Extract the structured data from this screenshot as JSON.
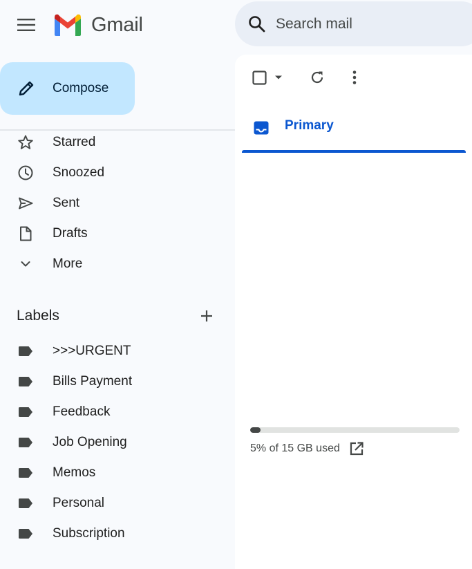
{
  "app": {
    "name": "Gmail"
  },
  "header": {
    "search": {
      "placeholder": "Search mail",
      "value": ""
    },
    "icons": {
      "menu": "hamburger-menu-icon",
      "logo": "gmail-m-logo",
      "search": "magnifier-icon"
    }
  },
  "compose": {
    "label": "Compose",
    "icon": "pencil-icon"
  },
  "nav": {
    "items": [
      {
        "label": "Starred",
        "icon": "star-icon"
      },
      {
        "label": "Snoozed",
        "icon": "clock-icon"
      },
      {
        "label": "Sent",
        "icon": "send-icon"
      },
      {
        "label": "Drafts",
        "icon": "draft-file-icon"
      },
      {
        "label": "More",
        "icon": "chevron-down-icon"
      }
    ]
  },
  "labels": {
    "title": "Labels",
    "items": [
      {
        "label": ">>>URGENT"
      },
      {
        "label": "Bills Payment"
      },
      {
        "label": "Feedback"
      },
      {
        "label": "Job Opening"
      },
      {
        "label": "Memos"
      },
      {
        "label": "Personal"
      },
      {
        "label": "Subscription"
      }
    ]
  },
  "main": {
    "tabs": [
      {
        "label": "Primary",
        "icon": "inbox-icon",
        "selected": true
      }
    ],
    "storage": {
      "text": "5% of 15 GB used",
      "fraction_used": 0.05
    }
  },
  "colors": {
    "background": "#f8fafd",
    "compose": "#c2e7ff",
    "search": "#e9eef6",
    "accent": "#0b57d0",
    "icon": "#444746"
  }
}
